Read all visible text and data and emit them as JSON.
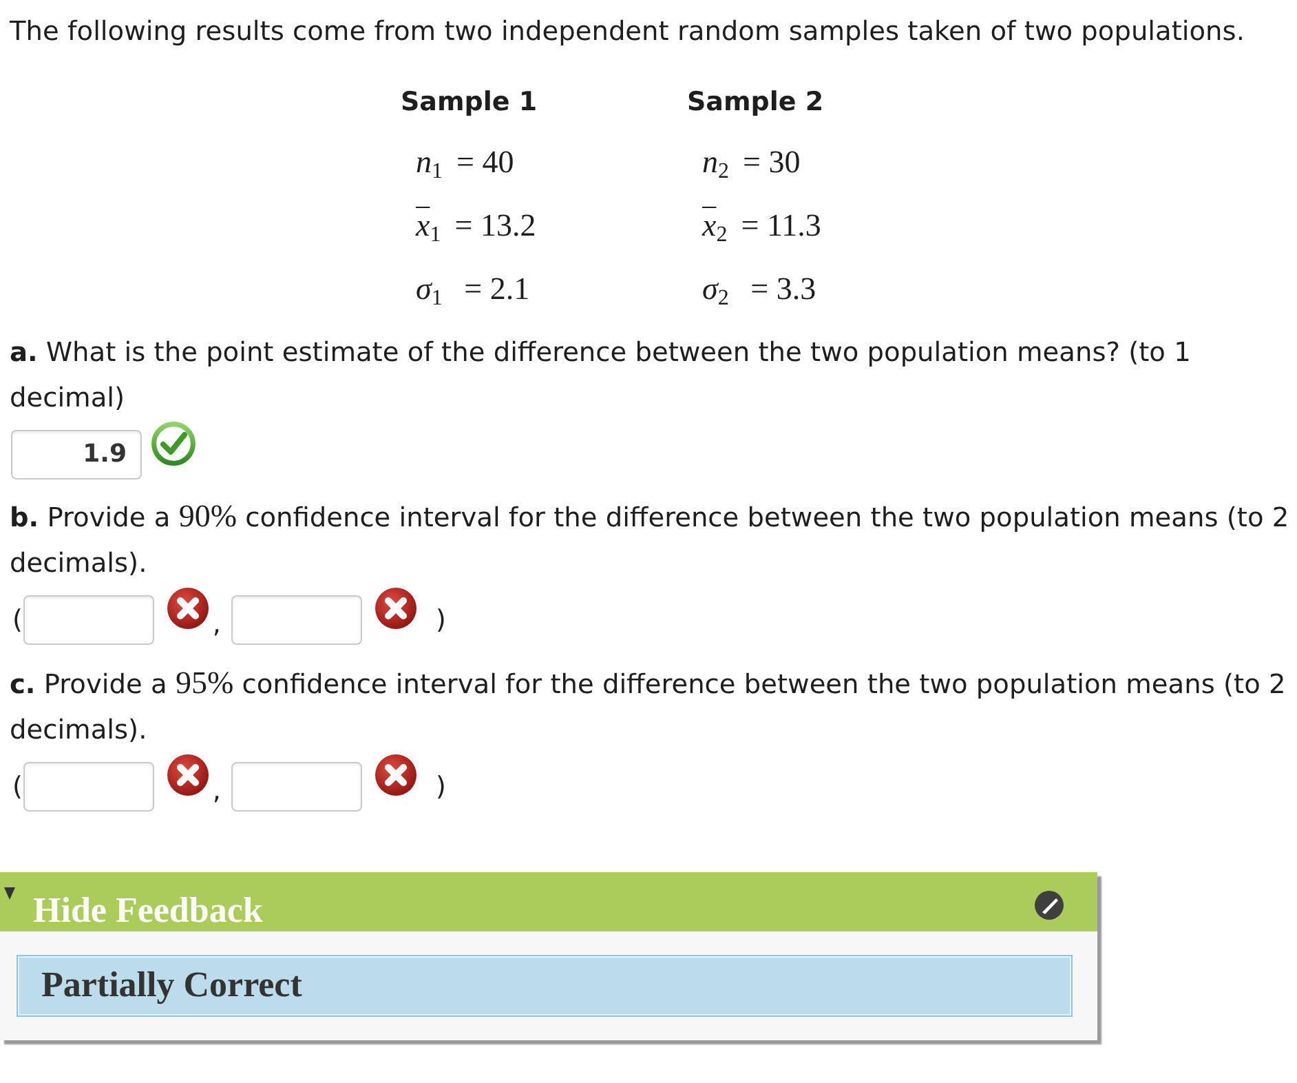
{
  "intro": "The following results come from two independent random samples taken of two populations.",
  "samples": [
    {
      "heading": "Sample 1",
      "stats": [
        {
          "symbol": "n",
          "subscript": "1",
          "overline": false,
          "value": "= 40"
        },
        {
          "symbol": "x",
          "subscript": "1",
          "overline": true,
          "value": "= 13.2"
        },
        {
          "symbol": "σ",
          "subscript": "1",
          "overline": false,
          "value": " = 2.1"
        }
      ]
    },
    {
      "heading": "Sample 2",
      "stats": [
        {
          "symbol": "n",
          "subscript": "2",
          "overline": false,
          "value": "= 30"
        },
        {
          "symbol": "x",
          "subscript": "2",
          "overline": true,
          "value": "= 11.3"
        },
        {
          "symbol": "σ",
          "subscript": "2",
          "overline": false,
          "value": " = 3.3"
        }
      ]
    }
  ],
  "questions": [
    {
      "text": [
        {
          "kind": "label",
          "text": "a."
        },
        {
          "kind": "plain",
          "text": " What is the point estimate of the difference between the two population means? (to 1 decimal)"
        }
      ],
      "answer": {
        "kind": "single",
        "fields": [
          {
            "value": "1.9",
            "correct": true
          }
        ]
      }
    },
    {
      "text": [
        {
          "kind": "label",
          "text": "b."
        },
        {
          "kind": "plain",
          "text": " Provide a "
        },
        {
          "kind": "math",
          "text": "90%"
        },
        {
          "kind": "plain",
          "text": " confidence interval for the difference between the two population means (to 2 decimals)."
        }
      ],
      "answer": {
        "kind": "interval",
        "open": "(",
        "separator": ",",
        "close": ")",
        "fields": [
          {
            "correct": false
          },
          {
            "correct": false
          }
        ]
      }
    },
    {
      "text": [
        {
          "kind": "label",
          "text": "c."
        },
        {
          "kind": "plain",
          "text": " Provide a "
        },
        {
          "kind": "math",
          "text": "95%"
        },
        {
          "kind": "plain",
          "text": " confidence interval for the difference between the two population means (to 2 decimals)."
        }
      ],
      "answer": {
        "kind": "interval",
        "open": "(",
        "separator": ",",
        "close": ")",
        "fields": [
          {
            "correct": false
          },
          {
            "correct": false
          }
        ]
      }
    }
  ],
  "feedback": {
    "toggle": "Hide Feedback",
    "expanded": true,
    "result": "Partially Correct"
  }
}
